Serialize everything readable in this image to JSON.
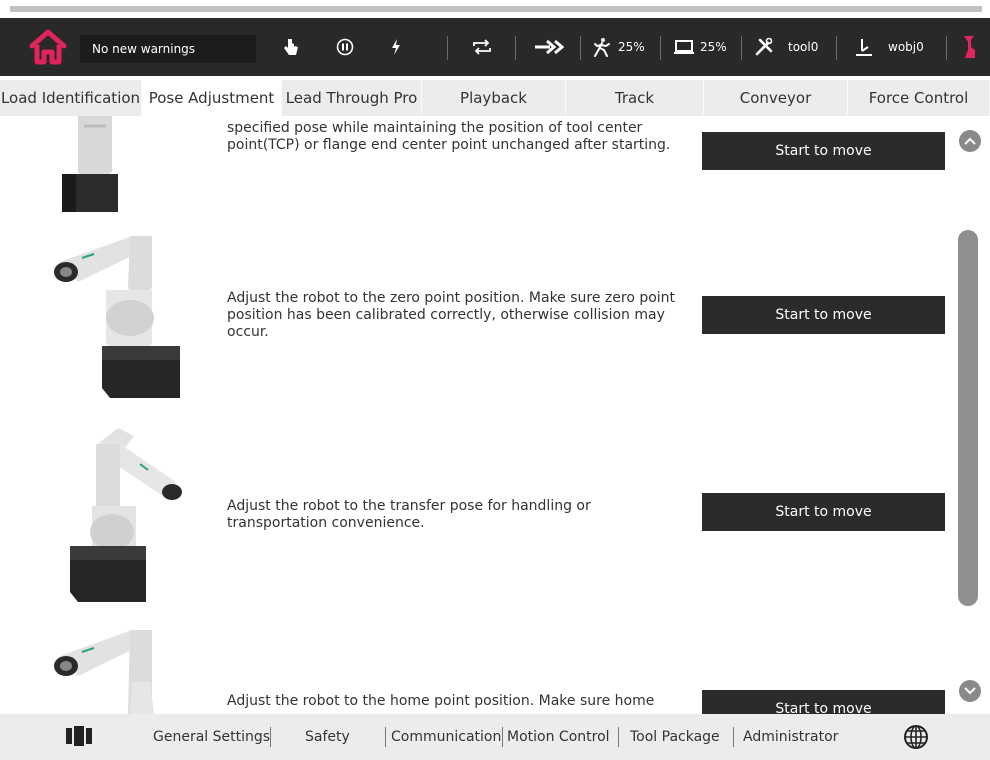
{
  "status_bar": {
    "warning_text": "No new warnings",
    "speed_run": "25%",
    "speed_screen": "25%",
    "tool": "tool0",
    "wobj": "wobj0",
    "accent_color": "#e0245e"
  },
  "tabs": [
    {
      "label": "Load Identification"
    },
    {
      "label": "Pose Adjustment",
      "active": true
    },
    {
      "label": "Lead Through Pro"
    },
    {
      "label": "Playback"
    },
    {
      "label": "Track"
    },
    {
      "label": "Conveyor"
    },
    {
      "label": "Force Control"
    }
  ],
  "rows": [
    {
      "description": "specified pose while maintaining the position of tool center point(TCP) or flange end center point unchanged after starting.",
      "button": "Start to move"
    },
    {
      "description": "Adjust the robot to the zero point position. Make sure zero point position has been calibrated correctly, otherwise collision may occur.",
      "button": "Start to move"
    },
    {
      "description": "Adjust the robot to the transfer pose for handling or transportation convenience.",
      "button": "Start to move"
    },
    {
      "description": "Adjust the robot to the home point position. Make sure home",
      "button": "Start to move"
    }
  ],
  "bottom_nav": [
    {
      "label": "General Settings"
    },
    {
      "label": "Safety"
    },
    {
      "label": "Communication"
    },
    {
      "label": "Motion Control"
    },
    {
      "label": "Tool Package"
    },
    {
      "label": "Administrator"
    }
  ]
}
